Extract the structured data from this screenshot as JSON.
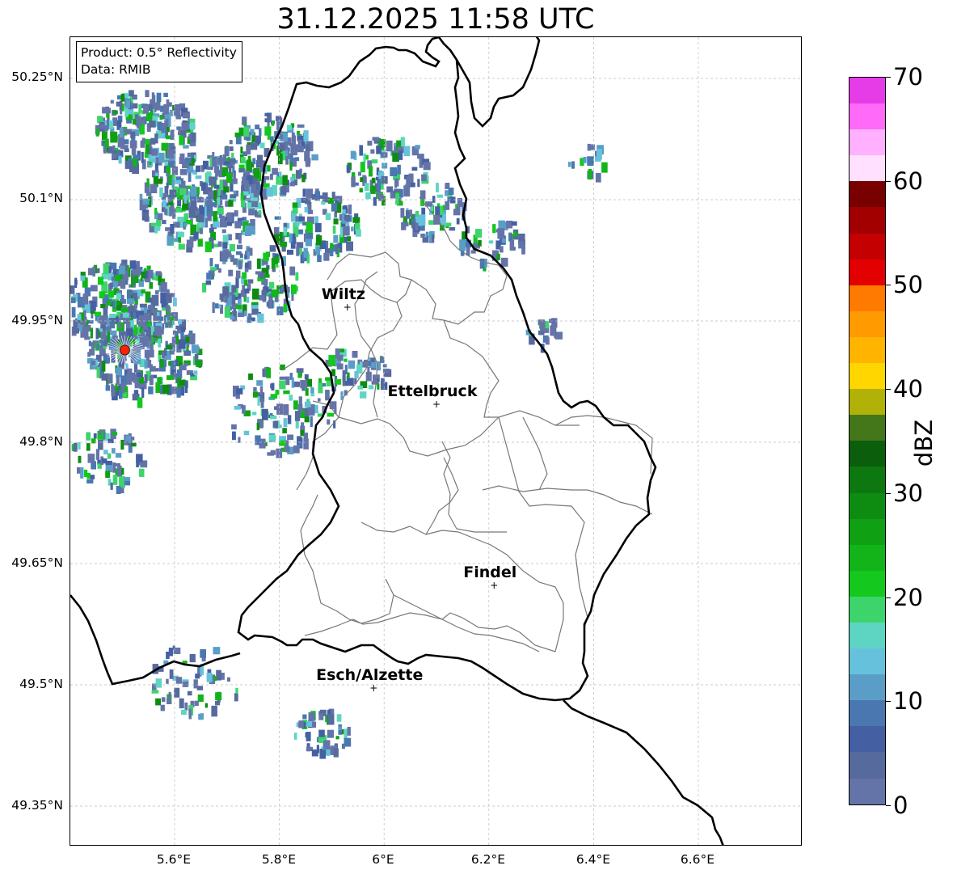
{
  "title": "31.12.2025 11:58 UTC",
  "info": {
    "product": "Product: 0.5° Reflectivity",
    "data_source": "Data: RMIB"
  },
  "axes": {
    "lat_labels": [
      "50.25°N",
      "50.1°N",
      "49.95°N",
      "49.8°N",
      "49.65°N",
      "49.5°N",
      "49.35°N"
    ],
    "lon_labels": [
      "5.6°E",
      "5.8°E",
      "6°E",
      "6.2°E",
      "6.4°E",
      "6.6°E"
    ]
  },
  "cities": [
    {
      "name": "Wiltz",
      "lon": 5.93,
      "lat": 49.967
    },
    {
      "name": "Ettelbruck",
      "lon": 6.1,
      "lat": 49.847
    },
    {
      "name": "Findel",
      "lon": 6.21,
      "lat": 49.623
    },
    {
      "name": "Esch/Alzette",
      "lon": 5.98,
      "lat": 49.496
    }
  ],
  "radar_site": {
    "lon": 5.505,
    "lat": 49.914,
    "color": "#ff2200"
  },
  "colorbar": {
    "label": "dBZ",
    "min": 0,
    "max": 70,
    "tick_labels": [
      "0",
      "10",
      "20",
      "30",
      "40",
      "50",
      "60",
      "70"
    ],
    "colors": [
      "#6474a8",
      "#566a9e",
      "#4560a2",
      "#4a77b0",
      "#5a9ec8",
      "#66c2dc",
      "#5ed5c2",
      "#3ed46c",
      "#14c81e",
      "#12b41a",
      "#10a014",
      "#0e8c12",
      "#0c780f",
      "#0a5e0c",
      "#44761a",
      "#b0b208",
      "#ffd600",
      "#ffb400",
      "#ff9a00",
      "#ff7a00",
      "#e20000",
      "#c40000",
      "#a20000",
      "#780000",
      "#ffe0ff",
      "#ffb0ff",
      "#ff6af8",
      "#e63ce8"
    ]
  },
  "colors": {
    "border": "#000000",
    "canton": "#777777",
    "grid": "#bbbbbb"
  }
}
